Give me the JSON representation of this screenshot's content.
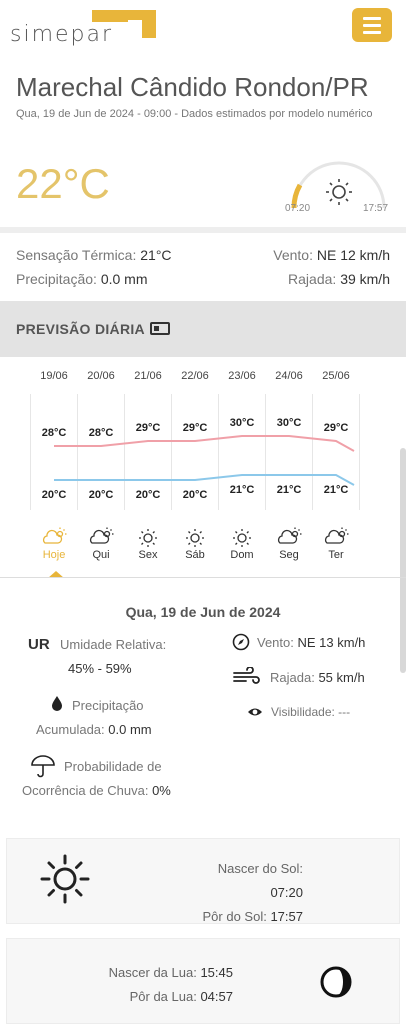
{
  "header": {
    "logo_text": "simepar"
  },
  "location": {
    "city": "Marechal Cândido Rondon/PR",
    "subtitle": "Qua, 19 de Jun de 2024 - 09:00 - Dados estimados por modelo numérico",
    "temperature": "22°C",
    "sunrise_time": "07:20",
    "sunset_time": "17:57"
  },
  "current": {
    "feels_label": "Sensação Térmica:",
    "feels_value": "21°C",
    "precip_label": "Precipitação:",
    "precip_value": "0.0 mm",
    "wind_label": "Vento:",
    "wind_value": "NE 12 km/h",
    "gust_label": "Rajada:",
    "gust_value": "39 km/h"
  },
  "daily": {
    "title": "PREVISÃO DIÁRIA"
  },
  "chart_data": {
    "type": "line",
    "categories": [
      "19/06",
      "20/06",
      "21/06",
      "22/06",
      "23/06",
      "24/06",
      "25/06"
    ],
    "series": [
      {
        "values": [
          28,
          28,
          29,
          29,
          30,
          30,
          29
        ],
        "color": "#f0a0a8"
      },
      {
        "values": [
          20,
          20,
          20,
          20,
          21,
          21,
          21
        ],
        "color": "#8cc8ea"
      }
    ],
    "max_labels": [
      "28°C",
      "28°C",
      "29°C",
      "29°C",
      "30°C",
      "30°C",
      "29°C"
    ],
    "min_labels": [
      "20°C",
      "20°C",
      "20°C",
      "20°C",
      "21°C",
      "21°C",
      "21°C"
    ],
    "day_names": [
      "Hoje",
      "Qui",
      "Sex",
      "Sáb",
      "Dom",
      "Seg",
      "Ter"
    ],
    "day_icons": [
      "partly-cloudy-icon",
      "partly-cloudy-icon",
      "sun-icon",
      "sun-icon",
      "sun-icon",
      "partly-cloudy-icon",
      "partly-cloudy-icon"
    ],
    "selected_index": 0,
    "accent": "#e8b53a"
  },
  "detail": {
    "date": "Qua, 19 de Jun de 2024",
    "ur_abbr": "UR",
    "ur_label": "Umidade Relativa:",
    "ur_value": "45% - 59%",
    "precip_label": "Precipitação",
    "precip_acc_label": "Acumulada:",
    "precip_acc_value": "0.0 mm",
    "prob_label": "Probabilidade de",
    "prob_label2": "Ocorrência de Chuva:",
    "prob_value": "0%",
    "wind_label": "Vento:",
    "wind_value": "NE 13 km/h",
    "gust_label": "Rajada:",
    "gust_value": "55 km/h",
    "visibility_label": "Visibilidade:",
    "visibility_value": "---"
  },
  "sun": {
    "rise_label": "Nascer do Sol:",
    "rise_value": "07:20",
    "set_label": "Pôr do Sol:",
    "set_value": "17:57"
  },
  "moon": {
    "rise_label": "Nascer da Lua:",
    "rise_value": "15:45",
    "set_label": "Pôr da Lua:",
    "set_value": "04:57"
  },
  "colors": {
    "accent": "#e8b53a",
    "temp": "#e4c46a",
    "max_line": "#f0a0a8",
    "min_line": "#8cc8ea"
  }
}
